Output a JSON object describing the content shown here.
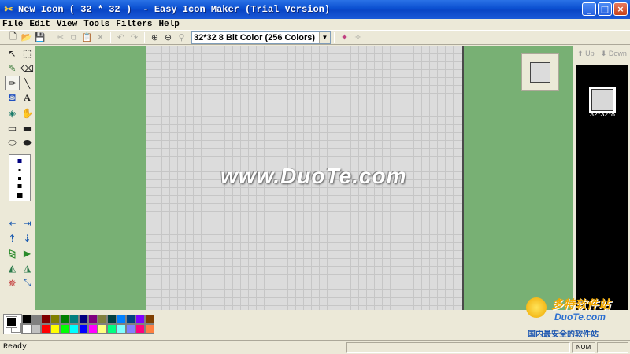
{
  "window": {
    "title": "New Icon ( 32 * 32 )  - Easy Icon Maker (Trial Version)",
    "controls": {
      "minimize": "_",
      "maximize": "□",
      "close": "×"
    }
  },
  "menu": {
    "items": [
      "File",
      "Edit",
      "View",
      "Tools",
      "Filters",
      "Help"
    ]
  },
  "toolbar": {
    "color_mode_selected": "32*32  8 Bit Color (256 Colors)",
    "icons": [
      "new-file-icon",
      "open-folder-icon",
      "save-icon",
      "cut-icon",
      "copy-icon",
      "paste-icon",
      "delete-icon",
      "undo-icon",
      "redo-icon",
      "zoom-in-icon",
      "zoom-out-icon",
      "zoom-icon",
      "add-format-icon",
      "remove-format-icon"
    ]
  },
  "tools": {
    "drawing": [
      "pointer-tool",
      "rectangle-select-tool",
      "eyedropper-tool",
      "eraser-tool",
      "pencil-tool",
      "line-tool",
      "fill-tool",
      "text-tool",
      "color-replace-tool",
      "hand-tool",
      "rectangle-outline-tool",
      "rectangle-filled-tool",
      "ellipse-outline-tool",
      "ellipse-filled-tool"
    ],
    "text_tool_label": "A",
    "transform": [
      "shift-left-tool",
      "shift-right-tool",
      "shift-up-tool",
      "shift-down-tool",
      "flip-horizontal-tool",
      "flip-vertical-tool",
      "rotate-left-tool",
      "rotate-right-tool",
      "magic-tool",
      "resize-tool"
    ],
    "selected": "pencil-tool"
  },
  "canvas": {
    "watermark": "www.DuoTe.com"
  },
  "formats_panel": {
    "nav_up": "Up",
    "nav_down": "Down",
    "items": [
      {
        "label": "32*32*8"
      }
    ]
  },
  "palette": {
    "foreground": "#000000",
    "background": "#ffffff",
    "row1": [
      "#000000",
      "#808080",
      "#800000",
      "#808000",
      "#008000",
      "#008080",
      "#000080",
      "#800080",
      "#808040",
      "#004040",
      "#0080ff",
      "#004080",
      "#8000ff",
      "#804000"
    ],
    "row2": [
      "#ffffff",
      "#c0c0c0",
      "#ff0000",
      "#ffff00",
      "#00ff00",
      "#00ffff",
      "#0000ff",
      "#ff00ff",
      "#ffff80",
      "#00ff80",
      "#80ffff",
      "#8080ff",
      "#ff0080",
      "#ff8040"
    ]
  },
  "status": {
    "text": "Ready",
    "num": "NUM"
  },
  "site_logo": {
    "cn": "多特软件站",
    "en": "DuoTe.com",
    "sub": "国内最安全的软件站"
  }
}
